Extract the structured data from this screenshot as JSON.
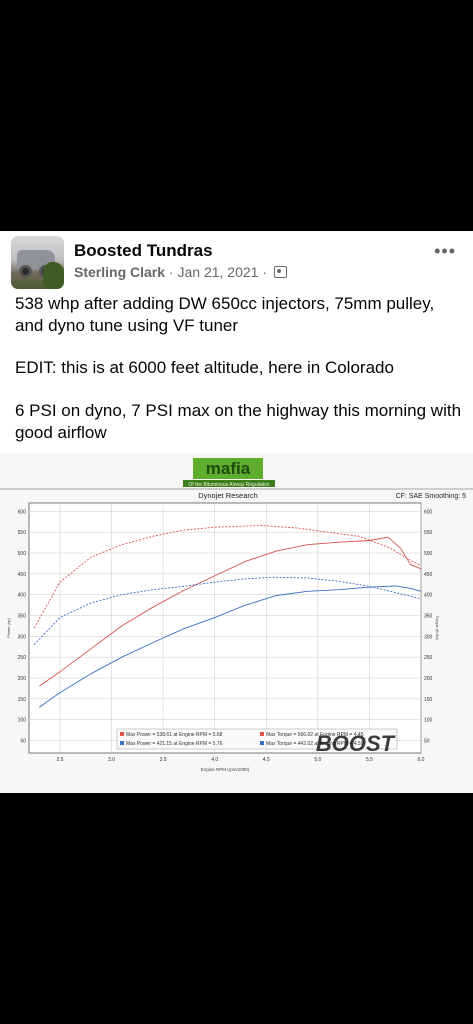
{
  "post": {
    "group_name": "Boosted Tundras",
    "author": "Sterling Clark",
    "separator": "·",
    "date": "Jan 21, 2021",
    "privacy_icon": "group-members-icon",
    "more_label": "•••",
    "paragraphs": [
      "538 whp after adding DW 650cc injectors, 75mm pulley, and dyno tune using VF tuner",
      "EDIT: this is at 6000 feet altitude, here in Colorado",
      "6 PSI on dyno, 7 PSI max on the highway this morning with good airflow"
    ]
  },
  "dyno_sheet": {
    "logo_text": "mafia",
    "logo_subtitle": "Of the Bituminous Airway Regulation",
    "brand": "Dynojet Research",
    "cf_label": "CF: SAE Smoothing: 5",
    "watermark": "BOOST"
  },
  "chart_data": {
    "type": "line",
    "title": "Dynojet Research",
    "xlabel": "Engine RPM (rpm/1000)",
    "ylabel": "Power (hp)",
    "y2label": "Torque (ft-lbs)",
    "xlim": [
      2.2,
      6.0
    ],
    "ylim": [
      20,
      620
    ],
    "x_ticks": [
      "2.5",
      "3.0",
      "3.5",
      "4.0",
      "4.5",
      "5.0",
      "5.5",
      "6.0"
    ],
    "y_ticks": [
      "600",
      "550",
      "500",
      "450",
      "400",
      "350",
      "300",
      "250",
      "200",
      "150",
      "100",
      "50"
    ],
    "y2_ticks": [
      "600",
      "550",
      "500",
      "450",
      "400",
      "350",
      "300",
      "250",
      "200",
      "150",
      "100",
      "50"
    ],
    "grid": true,
    "legend": [
      {
        "text": "Max Power = 538.61 at Engine RPM = 5.68",
        "color": "#d9534f"
      },
      {
        "text": "Max Torque = 566.02 at Engine RPM = 4.45",
        "color": "#d9534f"
      },
      {
        "text": "Max Power = 421.15 at Engine RPM = 5.76",
        "color": "#3a6fc4"
      },
      {
        "text": "Max Torque = 442.02 at Engine RPM = 4.59",
        "color": "#3a6fc4"
      }
    ],
    "series": [
      {
        "color": "#d9534f",
        "dashed": false,
        "x": [
          2.3,
          2.5,
          2.8,
          3.1,
          3.4,
          3.7,
          4.0,
          4.3,
          4.6,
          4.9,
          5.2,
          5.5,
          5.68,
          5.8,
          5.9,
          6.0
        ],
        "y": [
          180,
          215,
          270,
          325,
          370,
          410,
          445,
          480,
          505,
          520,
          526,
          530,
          538,
          512,
          472,
          462
        ]
      },
      {
        "color": "#d9534f",
        "dashed": true,
        "x": [
          2.25,
          2.5,
          2.8,
          3.1,
          3.4,
          3.7,
          4.0,
          4.45,
          4.8,
          5.1,
          5.4,
          5.7,
          5.9,
          6.0
        ],
        "y": [
          320,
          430,
          490,
          520,
          540,
          555,
          562,
          566,
          560,
          550,
          540,
          512,
          482,
          470
        ]
      },
      {
        "color": "#3a6fc4",
        "dashed": false,
        "x": [
          2.3,
          2.5,
          2.8,
          3.1,
          3.4,
          3.7,
          4.0,
          4.3,
          4.6,
          4.9,
          5.2,
          5.5,
          5.76,
          5.9,
          6.0
        ],
        "y": [
          130,
          165,
          210,
          250,
          285,
          318,
          345,
          375,
          398,
          408,
          412,
          418,
          421,
          415,
          408
        ]
      },
      {
        "color": "#3a6fc4",
        "dashed": true,
        "x": [
          2.25,
          2.5,
          2.8,
          3.1,
          3.4,
          3.7,
          4.0,
          4.3,
          4.59,
          4.9,
          5.2,
          5.5,
          5.8,
          6.0
        ],
        "y": [
          280,
          345,
          380,
          400,
          412,
          420,
          430,
          438,
          442,
          440,
          432,
          420,
          402,
          390
        ]
      }
    ]
  }
}
